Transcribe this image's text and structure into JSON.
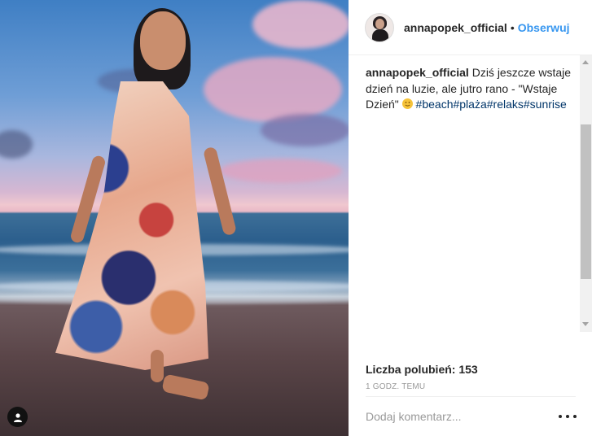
{
  "post": {
    "username": "annapopek_official",
    "separator": "•",
    "follow_label": "Obserwuj",
    "caption": {
      "user": "annapopek_official",
      "text": "Dziś jeszcze wstaje dzień na luzie, ale jutro rano - \"Wstaje Dzień\"",
      "emoji": "slightly-smiling-face",
      "hashtags": [
        "#beach",
        "#plaża",
        "#relaks",
        "#sunrise"
      ]
    },
    "likes_text": "Liczba polubień: 153",
    "time_text": "1 godz. temu",
    "comment_placeholder": "Dodaj komentarz..."
  },
  "photo": {
    "description_icon": "user-tag-icon"
  },
  "colors": {
    "follow": "#3897f0",
    "hashtag": "#003569",
    "text": "#262626",
    "muted": "#999999"
  }
}
